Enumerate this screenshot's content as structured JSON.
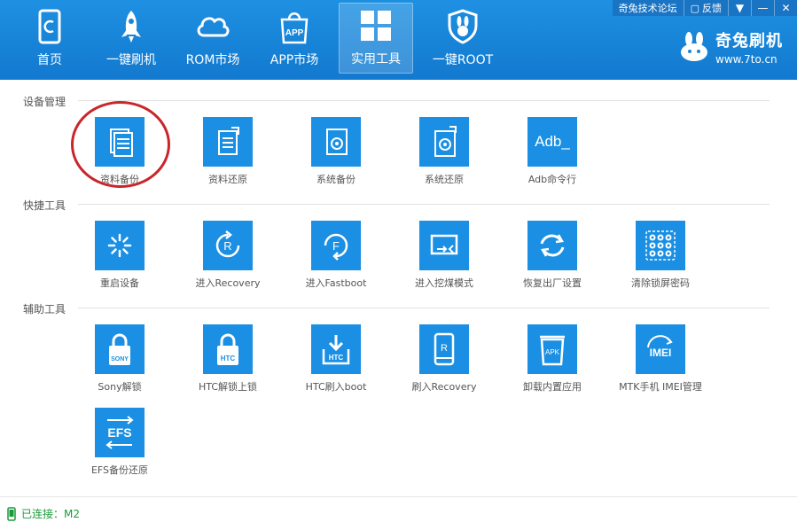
{
  "nav": {
    "items": [
      {
        "label": "首页",
        "icon": "home-phone-icon"
      },
      {
        "label": "一键刷机",
        "icon": "rocket-icon"
      },
      {
        "label": "ROM市场",
        "icon": "cloud-icon"
      },
      {
        "label": "APP市场",
        "icon": "shopping-bag-icon"
      },
      {
        "label": "实用工具",
        "icon": "grid-icon"
      },
      {
        "label": "一键ROOT",
        "icon": "rabbit-shield-icon"
      }
    ],
    "active": "实用工具"
  },
  "topbar": {
    "forum": "奇兔技术论坛",
    "feedback": "反馈"
  },
  "brand": {
    "name": "奇兔刷机",
    "url": "www.7to.cn"
  },
  "sections": {
    "device": {
      "title": "设备管理"
    },
    "quick": {
      "title": "快捷工具"
    },
    "aux": {
      "title": "辅助工具"
    }
  },
  "tools": {
    "backup": {
      "label": "资料备份"
    },
    "restore": {
      "label": "资料还原"
    },
    "sys_backup": {
      "label": "系统备份"
    },
    "sys_restore": {
      "label": "系统还原"
    },
    "adb": {
      "label": "Adb命令行",
      "icon_text": "Adb_"
    },
    "reboot": {
      "label": "重启设备"
    },
    "recovery": {
      "label": "进入Recovery",
      "icon_text": "R"
    },
    "fastboot": {
      "label": "进入Fastboot",
      "icon_text": "F"
    },
    "download": {
      "label": "进入挖煤模式"
    },
    "factory": {
      "label": "恢复出厂设置"
    },
    "unlock_pattern": {
      "label": "清除锁屏密码"
    },
    "sony": {
      "label": "Sony解锁",
      "icon_text": "SONY"
    },
    "htc_unlock": {
      "label": "HTC解锁上锁",
      "icon_text": "HTC"
    },
    "htc_boot": {
      "label": "HTC刷入boot",
      "icon_text": "HTC"
    },
    "flash_recovery": {
      "label": "刷入Recovery",
      "icon_text": "R"
    },
    "uninstall": {
      "label": "卸载内置应用",
      "icon_text": "APK"
    },
    "mtk_imei": {
      "label": "MTK手机 IMEI管理",
      "icon_text": "IMEI"
    },
    "efs": {
      "label": "EFS备份还原",
      "icon_text": "EFS"
    }
  },
  "status": {
    "connection": "已连接：M2"
  },
  "colors": {
    "header": "#1a84d9",
    "tile": "#1a8fe3",
    "highlight": "#c8262b",
    "connected": "#1a9a3a"
  }
}
